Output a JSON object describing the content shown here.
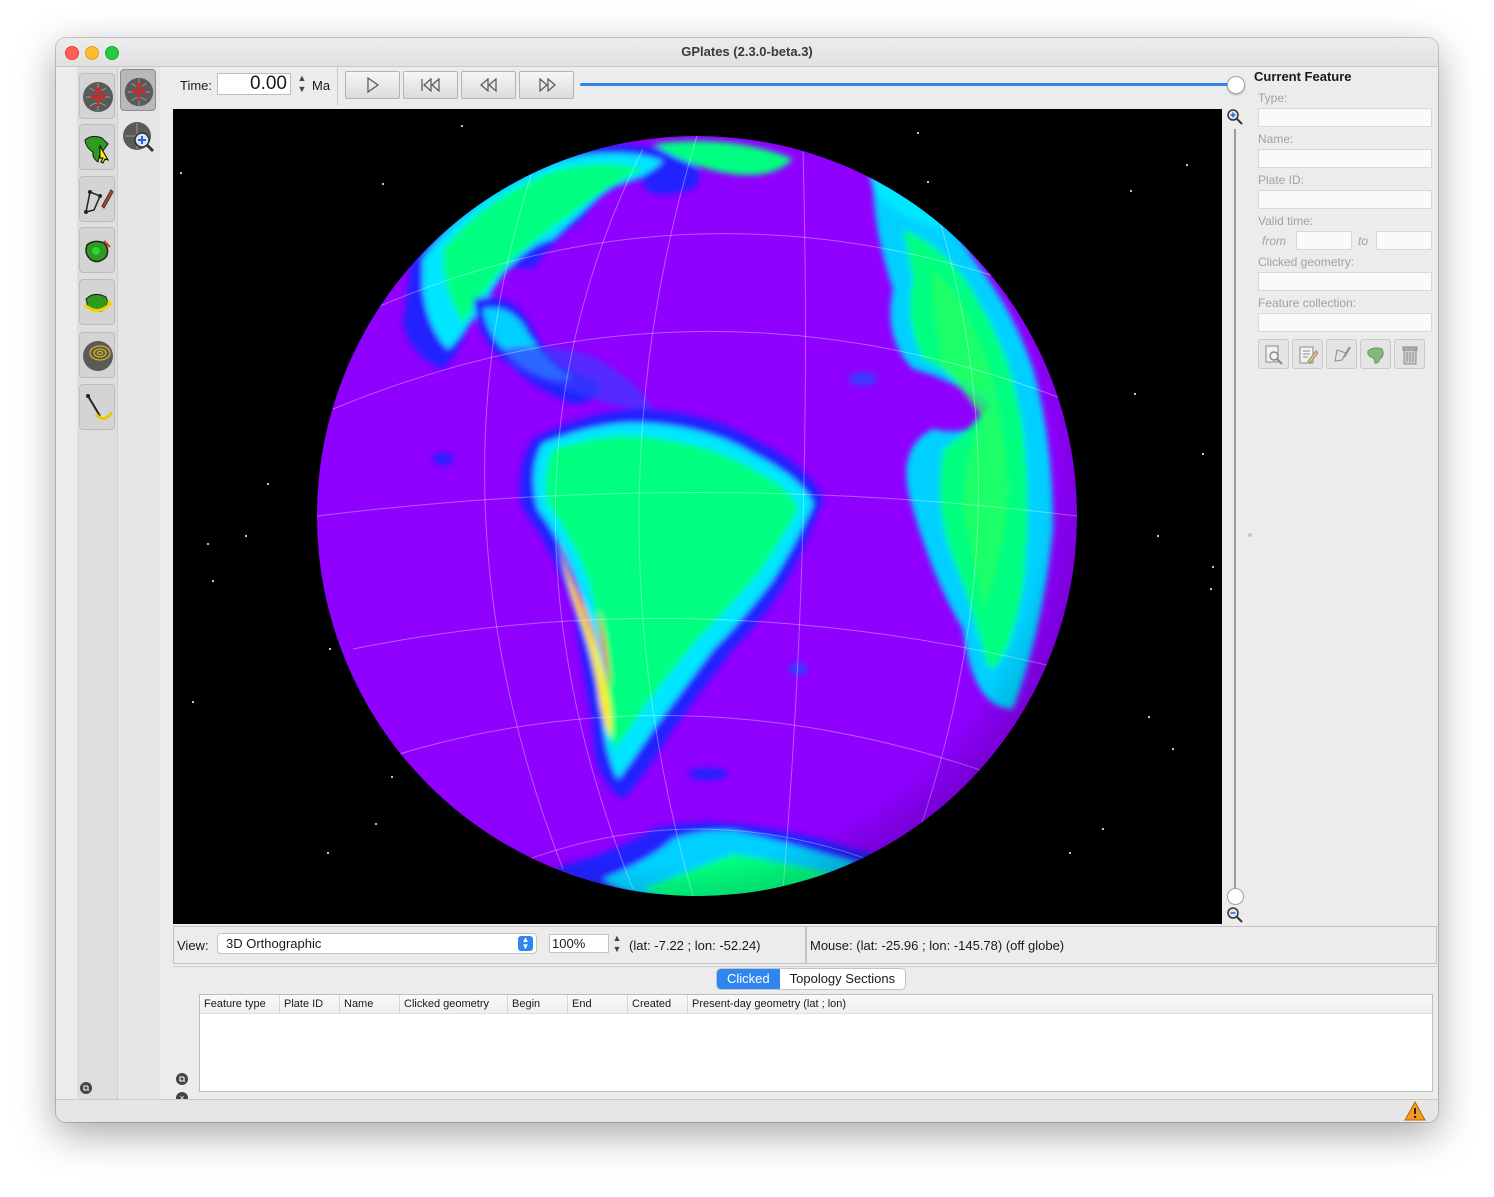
{
  "window": {
    "title": "GPlates (2.3.0-beta.3)"
  },
  "toolbar": {
    "tools_column1": [
      {
        "name": "drag-globe-tool-icon",
        "active": false
      },
      {
        "name": "choose-feature-tool-icon",
        "active": false
      },
      {
        "name": "digitise-geometry-tool-icon",
        "active": false
      },
      {
        "name": "build-topology-tool-icon",
        "active": false
      },
      {
        "name": "pole-manipulation-tool-icon",
        "active": false
      },
      {
        "name": "small-circle-tool-icon",
        "active": false
      },
      {
        "name": "measure-distance-tool-icon",
        "active": false
      }
    ],
    "tools_column2": [
      {
        "name": "reorient-globe-tool-icon",
        "active": true
      },
      {
        "name": "zoom-globe-tool-icon",
        "active": false
      }
    ]
  },
  "time_controls": {
    "time_label": "Time:",
    "time_value": "0.00",
    "unit": "Ma",
    "buttons": {
      "play": "play-icon",
      "reset": "reset-to-start-icon",
      "step_back": "step-back-icon",
      "step_forward": "step-forward-icon"
    },
    "slider_position": 1.0
  },
  "globe": {
    "projection": "3D Orthographic",
    "ocean_color": "#8f00ff",
    "space_color": "#000000"
  },
  "current_feature": {
    "title": "Current Feature",
    "fields": {
      "type_label": "Type:",
      "name_label": "Name:",
      "plate_id_label": "Plate ID:",
      "valid_time_label": "Valid time:",
      "from_label": "from",
      "to_label": "to",
      "clicked_geometry_label": "Clicked geometry:",
      "feature_collection_label": "Feature collection:"
    },
    "action_icons": [
      "query-feature-icon",
      "edit-feature-icon",
      "move-vertex-icon",
      "clone-feature-icon",
      "delete-feature-icon"
    ]
  },
  "view_bar": {
    "view_label": "View:",
    "projection_value": "3D Orthographic",
    "zoom_value": "100%",
    "camera_position": "(lat: -7.22 ; lon: -52.24)",
    "mouse_position": "Mouse: (lat: -25.96 ; lon: -145.78) (off globe)"
  },
  "bottom_panel": {
    "tabs": [
      {
        "label": "Clicked",
        "active": true
      },
      {
        "label": "Topology Sections",
        "active": false
      }
    ],
    "columns": [
      "Feature type",
      "Plate ID",
      "Name",
      "Clicked geometry",
      "Begin",
      "End",
      "Created",
      "Present-day geometry (lat ; lon)"
    ]
  },
  "status": {
    "warning_icon": "warning-icon"
  }
}
